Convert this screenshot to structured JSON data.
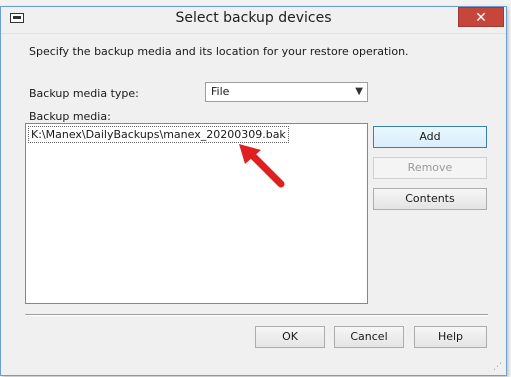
{
  "background": {
    "partial_text": "..."
  },
  "dialog": {
    "title": "Select backup devices",
    "close_label": "✕",
    "description": "Specify the backup media and its location for your restore operation.",
    "media_type_label": "Backup media type:",
    "media_type_value": "File",
    "media_label": "Backup media:",
    "media_items": [
      "K:\\Manex\\DailyBackups\\manex_20200309.bak"
    ],
    "buttons": {
      "add": "Add",
      "remove": "Remove",
      "contents": "Contents",
      "ok": "OK",
      "cancel": "Cancel",
      "help": "Help"
    }
  },
  "colors": {
    "close_button": "#c7463b",
    "annotation_arrow": "#e02020"
  }
}
